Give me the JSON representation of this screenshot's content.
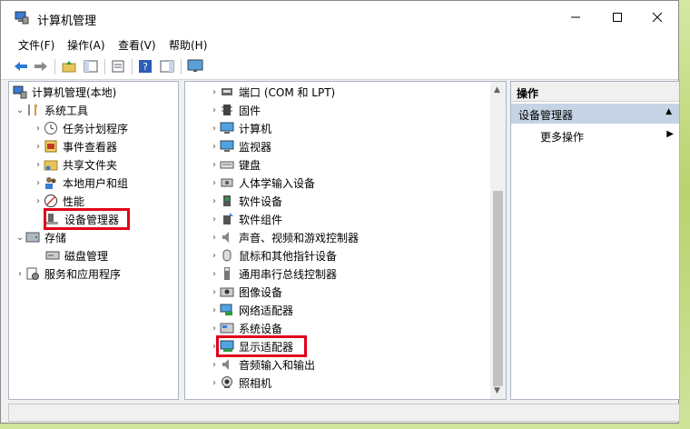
{
  "window": {
    "title": "计算机管理"
  },
  "menu": [
    "文件(F)",
    "操作(A)",
    "查看(V)",
    "帮助(H)"
  ],
  "left_tree": {
    "root": "计算机管理(本地)",
    "system_tools": "系统工具",
    "items": [
      "任务计划程序",
      "事件查看器",
      "共享文件夹",
      "本地用户和组",
      "性能",
      "设备管理器"
    ],
    "storage": "存储",
    "disk": "磁盘管理",
    "services": "服务和应用程序"
  },
  "devices": [
    "端口 (COM 和 LPT)",
    "固件",
    "计算机",
    "监视器",
    "键盘",
    "人体学输入设备",
    "软件设备",
    "软件组件",
    "声音、视频和游戏控制器",
    "鼠标和其他指针设备",
    "通用串行总线控制器",
    "图像设备",
    "网络适配器",
    "系统设备",
    "显示适配器",
    "音频输入和输出",
    "照相机"
  ],
  "actions": {
    "header": "操作",
    "selected": "设备管理器",
    "more": "更多操作"
  }
}
